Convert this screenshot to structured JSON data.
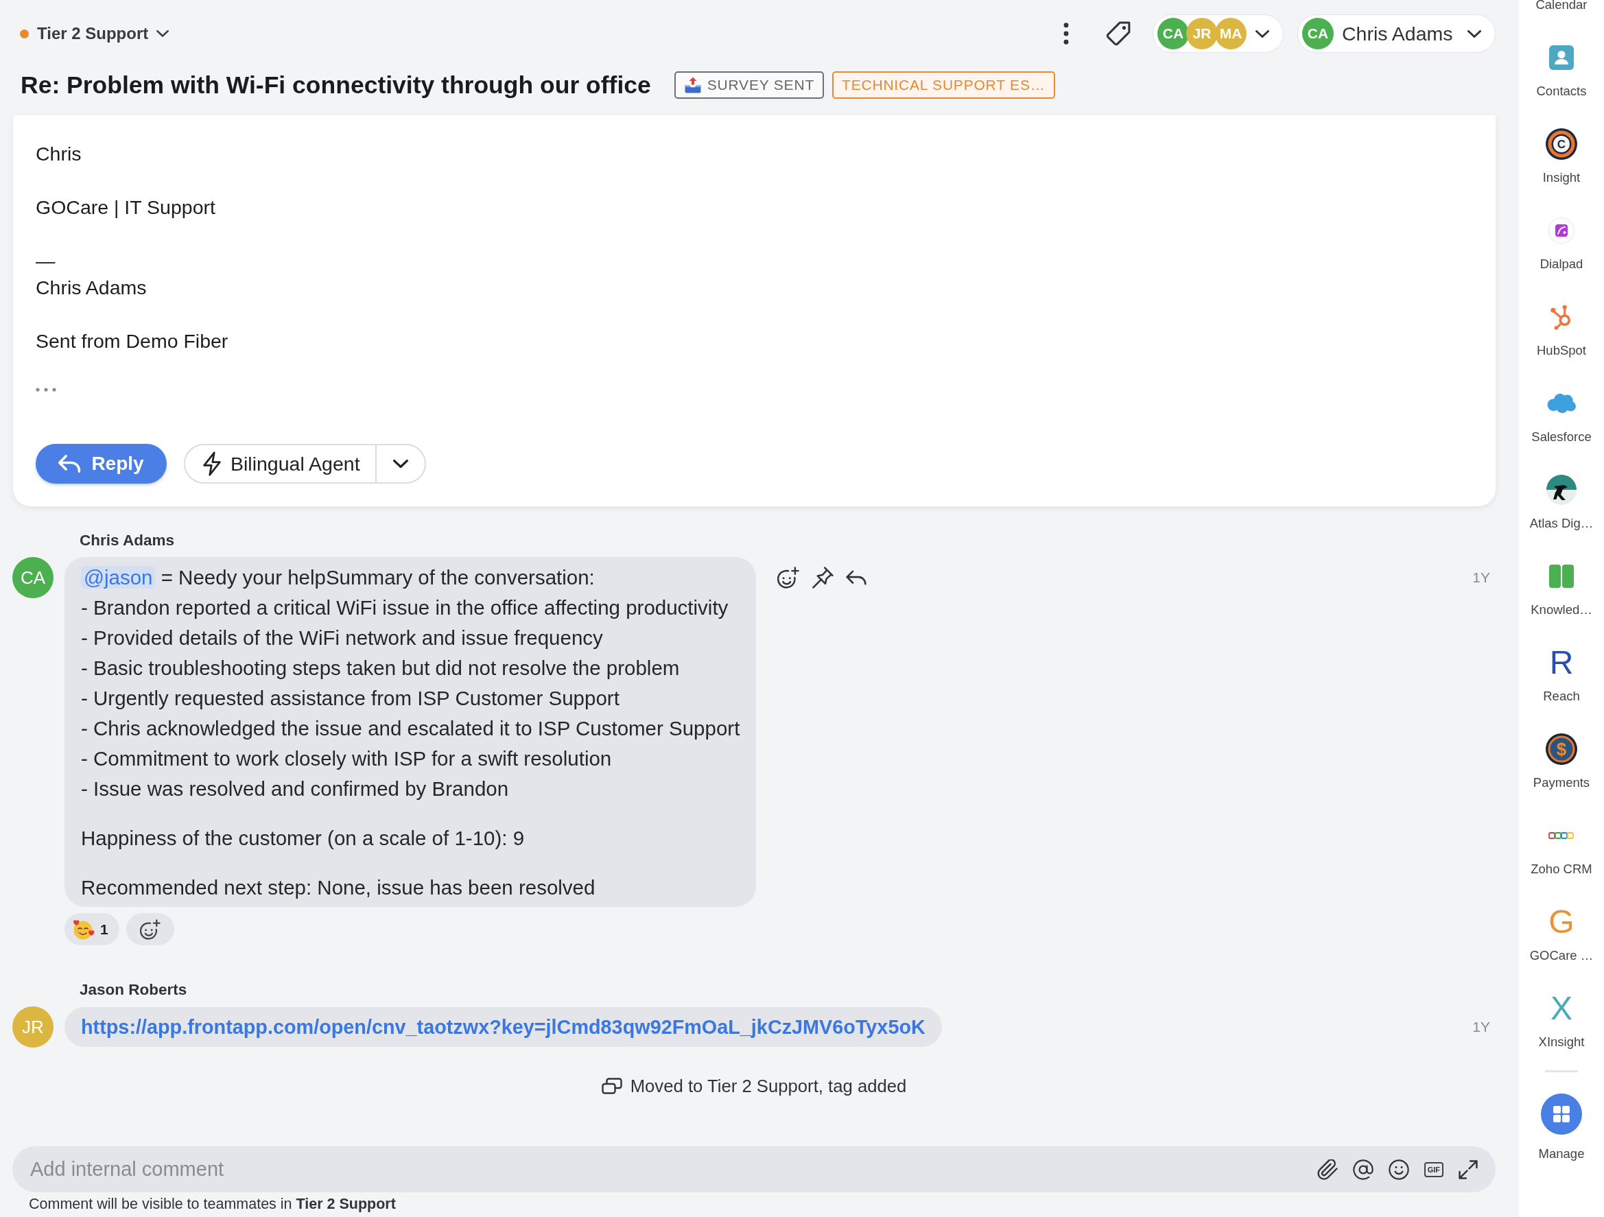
{
  "header": {
    "inbox": {
      "name": "Tier 2 Support",
      "color": "#e8892f"
    },
    "participants": [
      {
        "initials": "CA",
        "color": "#4caf50"
      },
      {
        "initials": "JR",
        "color": "#dbb640"
      },
      {
        "initials": "MA",
        "color": "#dbb640"
      }
    ],
    "assignee": {
      "initials": "CA",
      "name": "Chris Adams",
      "color": "#4caf50"
    }
  },
  "subject": "Re: Problem with Wi-Fi connectivity through our office",
  "tags": [
    {
      "label": "SURVEY SENT",
      "kind": "survey"
    },
    {
      "label": "TECHNICAL SUPPORT ES…",
      "kind": "category"
    }
  ],
  "email": {
    "paragraphs": [
      [
        "Chris"
      ],
      [
        "GOCare | IT Support"
      ],
      [
        "—",
        "Chris Adams"
      ],
      [
        "Sent from Demo Fiber"
      ]
    ],
    "reply_label": "Reply",
    "macro_label": "Bilingual Agent"
  },
  "messages": [
    {
      "kind": "comment",
      "author": "Chris Adams",
      "initials": "CA",
      "color": "#4caf50",
      "hovered": true,
      "mention": "@jason",
      "intro": "= Needy your helpSummary of the conversation:",
      "lines": [
        "- Brandon reported a critical WiFi issue in the office affecting productivity",
        "- Provided details of the WiFi network and issue frequency",
        "- Basic troubleshooting steps taken but did not resolve the problem",
        "- Urgently requested assistance from ISP Customer Support",
        "- Chris acknowledged the issue and escalated it to ISP Customer Support",
        "- Commitment to work closely with ISP for a swift resolution",
        "- Issue was resolved and confirmed by Brandon"
      ],
      "paragraphs": [
        "Happiness of the customer (on a scale of 1-10): 9",
        "Recommended next step: None, issue has been resolved"
      ],
      "time": "1Y",
      "reactions": [
        {
          "count": "1"
        }
      ]
    },
    {
      "kind": "link",
      "author": "Jason Roberts",
      "initials": "JR",
      "color": "#dbb640",
      "hovered": false,
      "url": "https://app.frontapp.com/open/cnv_taotzwx?key=jlCmd83qw92FmOaL_jkCzJMV6oTyx5oK",
      "time": "1Y"
    }
  ],
  "event": {
    "text": "Moved to Tier 2 Support, tag added"
  },
  "composer": {
    "placeholder": "Add internal comment",
    "gif_label": "GIF",
    "note": "Comment will be visible to teammates in **Tier 2 Support**"
  },
  "sidebar": {
    "items": [
      {
        "label": "Calendar",
        "kind": "calendar"
      },
      {
        "label": "Contacts",
        "kind": "contacts"
      },
      {
        "label": "Insight",
        "kind": "insight",
        "glyph": "C"
      },
      {
        "label": "Dialpad",
        "kind": "dialpad"
      },
      {
        "label": "HubSpot",
        "kind": "hubspot"
      },
      {
        "label": "Salesforce",
        "kind": "salesforce"
      },
      {
        "label": "Atlas Dig…",
        "kind": "atlas"
      },
      {
        "label": "Knowled…",
        "kind": "knowledge"
      },
      {
        "label": "Reach",
        "kind": "letter",
        "glyph": "R",
        "color": "#2750b5"
      },
      {
        "label": "Payments",
        "kind": "payments",
        "glyph": "$"
      },
      {
        "label": "Zoho CRM",
        "kind": "zoho"
      },
      {
        "label": "GOCare …",
        "kind": "letter",
        "glyph": "G",
        "color": "#eb9236"
      },
      {
        "label": "XInsight",
        "kind": "letter",
        "glyph": "X",
        "color": "#49a9b9"
      }
    ],
    "manage": {
      "label": "Manage"
    }
  }
}
